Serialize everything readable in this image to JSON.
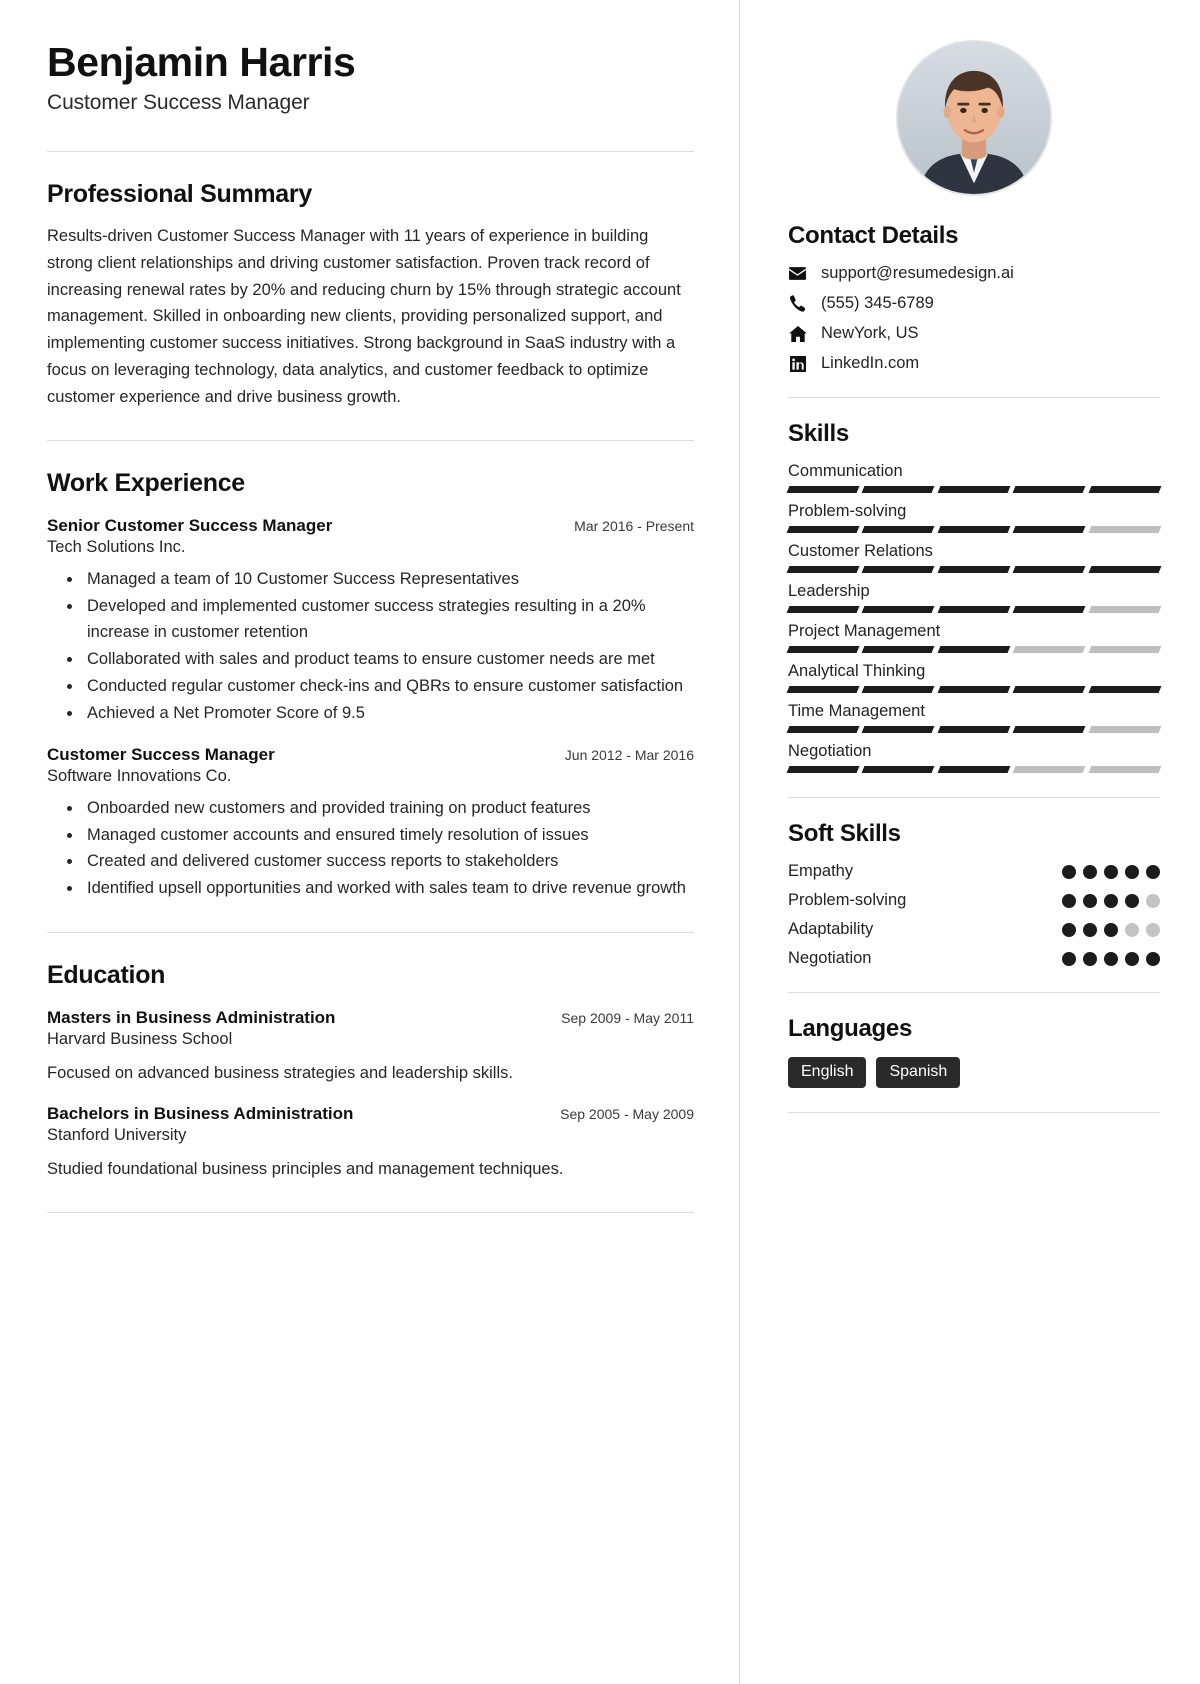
{
  "header": {
    "name": "Benjamin Harris",
    "job_title": "Customer Success Manager",
    "photo_alt": "profile-photo"
  },
  "summary": {
    "heading": "Professional Summary",
    "text": "Results-driven Customer Success Manager with 11 years of experience in building strong client relationships and driving customer satisfaction. Proven track record of increasing renewal rates by 20% and reducing churn by 15% through strategic account management. Skilled in onboarding new clients, providing personalized support, and implementing customer success initiatives. Strong background in SaaS industry with a focus on leveraging technology, data analytics, and customer feedback to optimize customer experience and drive business growth."
  },
  "work": {
    "heading": "Work Experience",
    "entries": [
      {
        "role": "Senior Customer Success Manager",
        "date": "Mar 2016 - Present",
        "org": "Tech Solutions Inc.",
        "bullets": [
          "Managed a team of 10 Customer Success Representatives",
          "Developed and implemented customer success strategies resulting in a 20% increase in customer retention",
          "Collaborated with sales and product teams to ensure customer needs are met",
          "Conducted regular customer check-ins and QBRs to ensure customer satisfaction",
          "Achieved a Net Promoter Score of 9.5"
        ]
      },
      {
        "role": "Customer Success Manager",
        "date": "Jun 2012 - Mar 2016",
        "org": "Software Innovations Co.",
        "bullets": [
          "Onboarded new customers and provided training on product features",
          "Managed customer accounts and ensured timely resolution of issues",
          "Created and delivered customer success reports to stakeholders",
          "Identified upsell opportunities and worked with sales team to drive revenue growth"
        ]
      }
    ]
  },
  "education": {
    "heading": "Education",
    "entries": [
      {
        "degree": "Masters in Business Administration",
        "date": "Sep 2009 - May 2011",
        "school": "Harvard Business School",
        "description": "Focused on advanced business strategies and leadership skills."
      },
      {
        "degree": "Bachelors in Business Administration",
        "date": "Sep 2005 - May 2009",
        "school": "Stanford University",
        "description": "Studied foundational business principles and management techniques."
      }
    ]
  },
  "contact": {
    "heading": "Contact Details",
    "items": [
      {
        "icon": "envelope-icon",
        "value": "support@resumedesign.ai"
      },
      {
        "icon": "phone-icon",
        "value": "(555) 345-6789"
      },
      {
        "icon": "home-icon",
        "value": "NewYork, US"
      },
      {
        "icon": "linkedin-icon",
        "value": "LinkedIn.com"
      }
    ]
  },
  "skills": {
    "heading": "Skills",
    "segments_total": 5,
    "items": [
      {
        "name": "Communication",
        "filled": 5
      },
      {
        "name": "Problem-solving",
        "filled": 4
      },
      {
        "name": "Customer Relations",
        "filled": 5
      },
      {
        "name": "Leadership",
        "filled": 4
      },
      {
        "name": "Project Management",
        "filled": 3
      },
      {
        "name": "Analytical Thinking",
        "filled": 5
      },
      {
        "name": "Time Management",
        "filled": 4
      },
      {
        "name": "Negotiation",
        "filled": 3
      }
    ]
  },
  "soft_skills": {
    "heading": "Soft Skills",
    "dots_total": 5,
    "items": [
      {
        "name": "Empathy",
        "filled": 5
      },
      {
        "name": "Problem-solving",
        "filled": 4
      },
      {
        "name": "Adaptability",
        "filled": 3
      },
      {
        "name": "Negotiation",
        "filled": 5
      }
    ]
  },
  "languages": {
    "heading": "Languages",
    "items": [
      "English",
      "Spanish"
    ]
  },
  "colors": {
    "accent": "#1c1c1c",
    "muted": "#bfbfbf",
    "divider": "#dddddd",
    "tag_bg": "#2a2a2a"
  }
}
